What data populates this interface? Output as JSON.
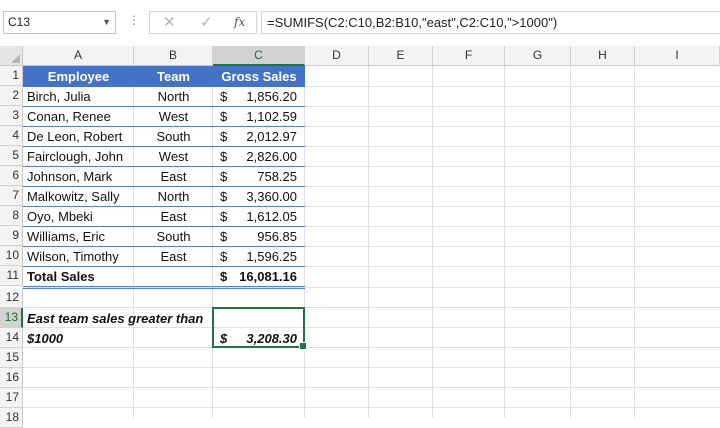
{
  "formula_bar": {
    "name_box": "C13",
    "fx_label": "fx",
    "formula": "=SUMIFS(C2:C10,B2:B10,\"east\",C2:C10,\">1000\")"
  },
  "columns": [
    "A",
    "B",
    "C",
    "D",
    "E",
    "F",
    "G",
    "H",
    "I"
  ],
  "rows": [
    "1",
    "2",
    "3",
    "4",
    "5",
    "6",
    "7",
    "8",
    "9",
    "10",
    "11",
    "12",
    "13",
    "14",
    "15",
    "16",
    "17",
    "18"
  ],
  "table": {
    "headers": {
      "employee": "Employee",
      "team": "Team",
      "gross_sales": "Gross Sales"
    },
    "records": [
      {
        "employee": "Birch, Julia",
        "team": "North",
        "currency": "$",
        "amount": "1,856.20"
      },
      {
        "employee": "Conan, Renee",
        "team": "West",
        "currency": "$",
        "amount": "1,102.59"
      },
      {
        "employee": "De Leon, Robert",
        "team": "South",
        "currency": "$",
        "amount": "2,012.97"
      },
      {
        "employee": "Fairclough, John",
        "team": "West",
        "currency": "$",
        "amount": "2,826.00"
      },
      {
        "employee": "Johnson, Mark",
        "team": "East",
        "currency": "$",
        "amount": "758.25"
      },
      {
        "employee": "Malkowitz, Sally",
        "team": "North",
        "currency": "$",
        "amount": "3,360.00"
      },
      {
        "employee": "Oyo, Mbeki",
        "team": "East",
        "currency": "$",
        "amount": "1,612.05"
      },
      {
        "employee": "Williams, Eric",
        "team": "South",
        "currency": "$",
        "amount": "956.85"
      },
      {
        "employee": "Wilson, Timothy",
        "team": "East",
        "currency": "$",
        "amount": "1,596.25"
      }
    ],
    "total": {
      "label": "Total Sales",
      "currency": "$",
      "amount": "16,081.16"
    }
  },
  "result": {
    "label_line1": "East team sales greater than",
    "label_line2": "$1000",
    "currency": "$",
    "amount": "3,208.30"
  },
  "colors": {
    "header_fill": "#4472c4",
    "selection": "#217346"
  }
}
